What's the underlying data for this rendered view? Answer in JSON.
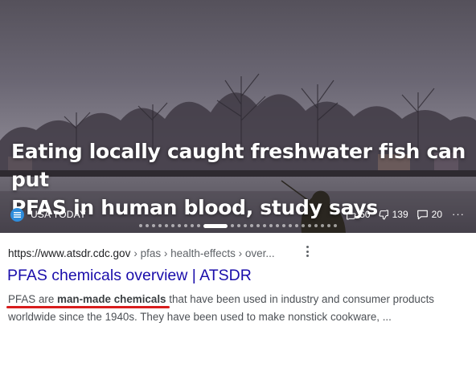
{
  "card": {
    "headline_line1": "Eating locally caught freshwater fish can put",
    "headline_line2": "PFAS in human blood, study says",
    "source_name": "USA TODAY",
    "likes": "50",
    "dislikes": "139",
    "comments": "20",
    "more_label": "···",
    "slide_count": 28,
    "active_slide": 10,
    "icons": [
      "usa-today-logo",
      "thumbs-up-icon",
      "thumbs-down-icon",
      "comment-icon",
      "more-icon"
    ]
  },
  "result": {
    "url_main": "https://www.atsdr.cdc.gov",
    "url_path": "› pfas › health-effects › over...",
    "title": "PFAS chemicals overview | ATSDR",
    "snippet_before": "PFAS are ",
    "snippet_bold": "man-made chemicals",
    "snippet_after1": " that have been used in industry and consumer products",
    "snippet_line2": "worldwide since the 1940s. They have been used to make nonstick cookware, ...",
    "annotation_color": "#d81c1c",
    "link_color": "#1a0dab"
  }
}
